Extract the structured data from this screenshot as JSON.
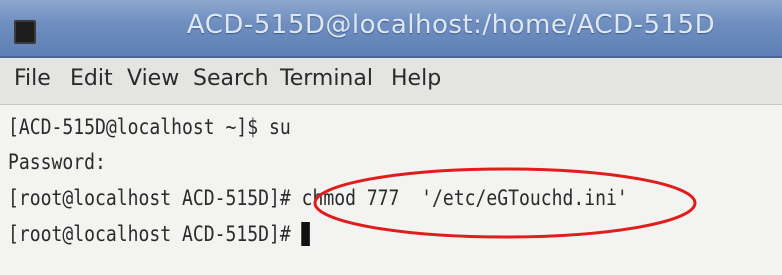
{
  "window": {
    "title": "ACD-515D@localhost:/home/ACD-515D"
  },
  "menu": {
    "items": [
      "File",
      "Edit",
      "View",
      "Search",
      "Terminal",
      "Help"
    ]
  },
  "terminal": {
    "lines": [
      "[ACD-515D@localhost ~]$ su",
      "Password:",
      "[root@localhost ACD-515D]# chmod 777  '/etc/eGTouchd.ini'",
      "[root@localhost ACD-515D]# "
    ]
  },
  "annotation": {
    "shape": "ellipse",
    "color": "#e01c1c",
    "target": "chmod 777  '/etc/eGTouchd.ini'"
  },
  "colors": {
    "titlebar": "#6f8fc0",
    "terminal_background": "#f3f3f1",
    "annotation": "#e01c1c"
  }
}
